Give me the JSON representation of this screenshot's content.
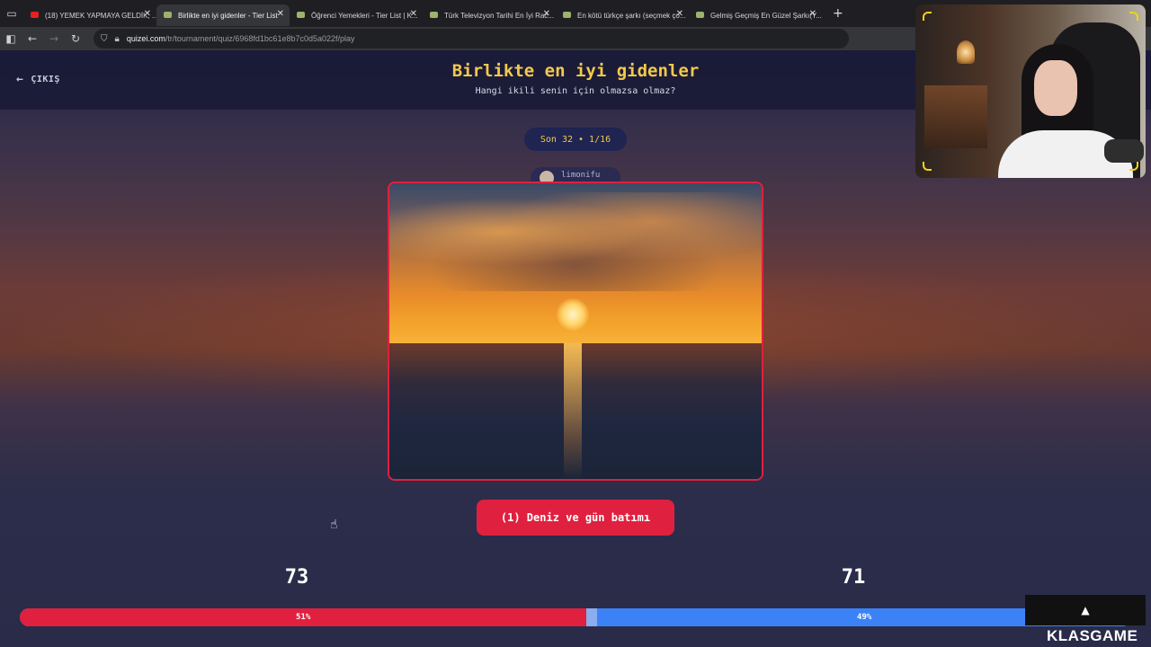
{
  "browser": {
    "tabs": [
      {
        "title": "(18) YEMEK YAPMAYA GELDİK, ...",
        "favicon": "youtube-icon",
        "active": false
      },
      {
        "title": "Birlikte en iyi gidenler - Tier List",
        "favicon": "quizei-icon",
        "active": true
      },
      {
        "title": "Öğrenci Yemekleri - Tier List | K...",
        "favicon": "quizei-icon",
        "active": false
      },
      {
        "title": "Türk Televizyon Tarihi En İyi Rac...",
        "favicon": "quizei-icon",
        "active": false
      },
      {
        "title": "En kötü türkçe şarkı (seçmek ço...",
        "favicon": "quizei-icon",
        "active": false
      },
      {
        "title": "Gelmiş Geçmiş En Güzel Şarkı(Y...",
        "favicon": "quizei-icon",
        "active": false
      }
    ],
    "url_host": "quizei.com",
    "url_path": "/tr/tournament/quiz/6968fd1bc61e8b7c0d5a022f/play"
  },
  "page": {
    "exit_label": "ÇIKIŞ",
    "title": "Birlikte en iyi gidenler",
    "subtitle": "Hangi ikili senin için olmazsa olmaz?",
    "round_label": "Son 32 • 1/16",
    "author": "limonifu",
    "choice_label": "(1) Deniz ve gün batımı",
    "scores": {
      "left": "73",
      "right": "71"
    },
    "vote_bar": {
      "left_percent_label": "51%",
      "right_percent_label": "49%",
      "left_fraction": 0.51
    },
    "colors": {
      "accent_red": "#e0203f",
      "accent_blue": "#3b82f6",
      "title_yellow": "#f2c94c"
    }
  },
  "overlay": {
    "brand": "KLASGAME"
  }
}
